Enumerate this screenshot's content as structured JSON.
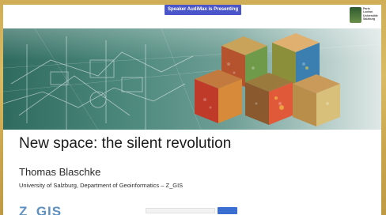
{
  "banner": {
    "text": "Speaker AudiMax is Presenting"
  },
  "slide": {
    "title": "New space: the silent revolution",
    "author": "Thomas Blaschke",
    "affiliation": "University of Salzburg, Department of Geoinformatics – Z_GIS",
    "footer_logo": "Z_GIS",
    "university_logo_lines": [
      "Paris",
      "Lodron",
      "Universität",
      "Salzburg"
    ]
  },
  "share_bar": {
    "message": "",
    "stop_label": "",
    "hide_label": ""
  },
  "colors": {
    "frame": "#cfae57",
    "presenting_badge": "#4a55c9",
    "zgis_blue": "#5d8fc0",
    "share_button": "#3a6ed0"
  },
  "icons": [
    "university-logo-icon",
    "satellite-imagery-banner"
  ]
}
